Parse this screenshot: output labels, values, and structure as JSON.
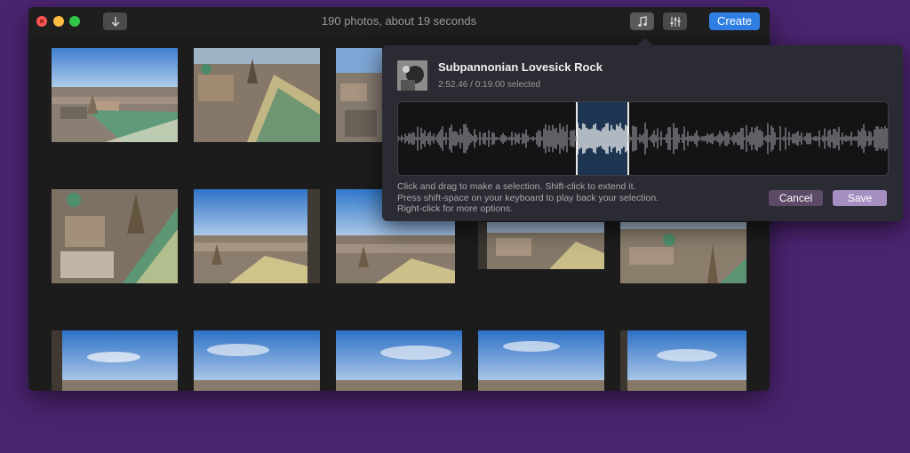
{
  "window": {
    "title": "190 photos, about 19 seconds",
    "create_label": "Create"
  },
  "icons": {
    "import": "down-arrow-icon",
    "music": "music-note-icon",
    "adjust": "sliders-icon"
  },
  "popover": {
    "song_title": "Subpannonian Lovesick Rock",
    "song_time": "2:52.46 / 0:19.00 selected",
    "help_lines": [
      "Click and drag to make a selection. Shift-click to extend it.",
      "Press shift-space on your keyboard to play back your selection.",
      "Right-click for more options."
    ],
    "cancel_label": "Cancel",
    "save_label": "Save"
  },
  "colors": {
    "background": "#4b2470",
    "accent": "#2f7ee3",
    "save_button": "#a58ec2",
    "selection": "#1d3550"
  }
}
